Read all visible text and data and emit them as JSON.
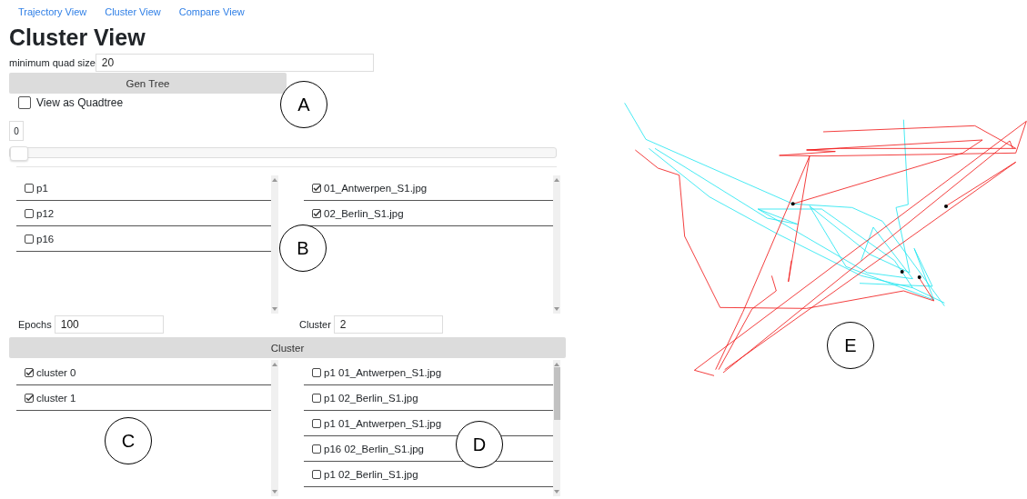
{
  "nav": [
    {
      "label": "Trajectory View"
    },
    {
      "label": "Cluster View"
    },
    {
      "label": "Compare View"
    }
  ],
  "title": "Cluster View",
  "min_quad": {
    "label": "minimum quad size",
    "value": "20"
  },
  "gen_tree_button": "Gen Tree",
  "view_as_quadtree": {
    "label": "View as Quadtree",
    "checked": false
  },
  "slider": {
    "value": "0",
    "level": 0
  },
  "participants": [
    {
      "label": "p1",
      "checked": false
    },
    {
      "label": "p12",
      "checked": false
    },
    {
      "label": "p16",
      "checked": false
    }
  ],
  "images": [
    {
      "label": "01_Antwerpen_S1.jpg",
      "checked": true
    },
    {
      "label": "02_Berlin_S1.jpg",
      "checked": true
    }
  ],
  "epochs": {
    "label": "Epochs",
    "value": "100"
  },
  "cluster_count": {
    "label": "Cluster",
    "value": "2"
  },
  "cluster_button": "Cluster",
  "clusters": [
    {
      "label": "cluster 0",
      "checked": true
    },
    {
      "label": "cluster 1",
      "checked": true
    }
  ],
  "members": [
    {
      "label": "p1 01_Antwerpen_S1.jpg",
      "checked": false
    },
    {
      "label": "p1 02_Berlin_S1.jpg",
      "checked": false
    },
    {
      "label": "p1 01_Antwerpen_S1.jpg",
      "checked": false
    },
    {
      "label": "p16 02_Berlin_S1.jpg",
      "checked": false
    },
    {
      "label": "p1 02_Berlin_S1.jpg",
      "checked": false
    }
  ],
  "callouts": [
    "A",
    "B",
    "C",
    "D",
    "E"
  ]
}
